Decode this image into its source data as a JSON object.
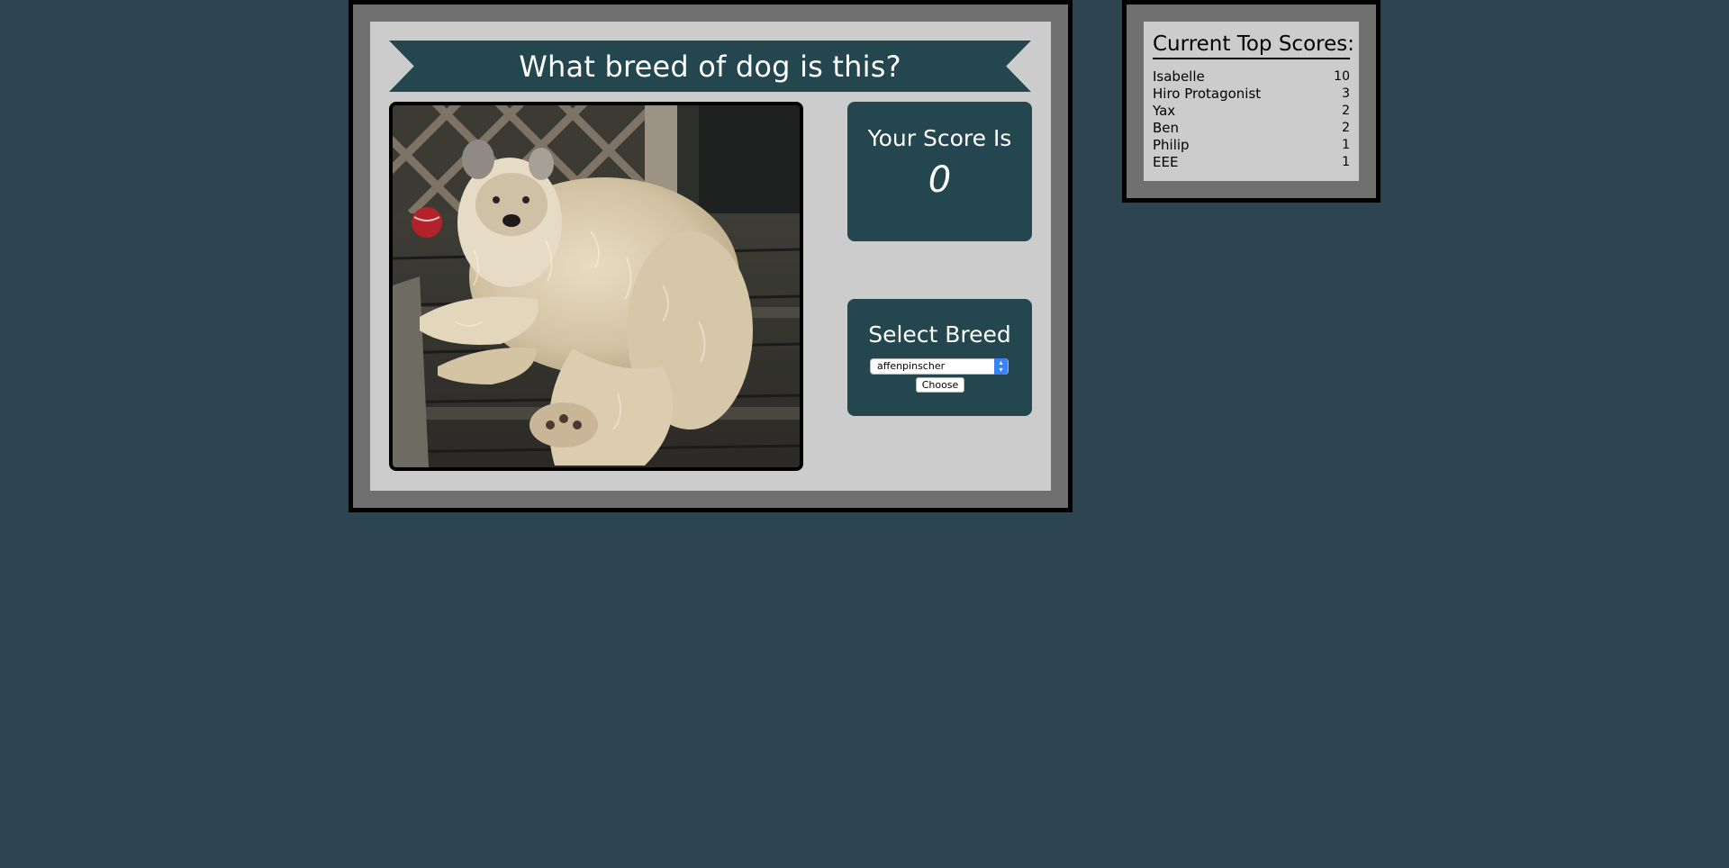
{
  "game": {
    "title": "What breed of dog is this?",
    "photo_alt": "dog-photo",
    "score_label": "Your Score Is",
    "score_value": "0",
    "select_label": "Select Breed",
    "selected_breed": "affenpinscher",
    "choose_label": "Choose"
  },
  "leaderboard": {
    "title": "Current Top Scores:",
    "entries": [
      {
        "name": "Isabelle",
        "score": "10"
      },
      {
        "name": "Hiro Protagonist",
        "score": "3"
      },
      {
        "name": "Yax",
        "score": "2"
      },
      {
        "name": "Ben",
        "score": "2"
      },
      {
        "name": "Philip",
        "score": "1"
      },
      {
        "name": "EEE",
        "score": "1"
      }
    ]
  },
  "colors": {
    "background": "#2d4550",
    "panel_dark": "#24464f",
    "frame_gray": "#707070",
    "card_gray": "#cccccc",
    "select_accent": "#3a82f6"
  }
}
